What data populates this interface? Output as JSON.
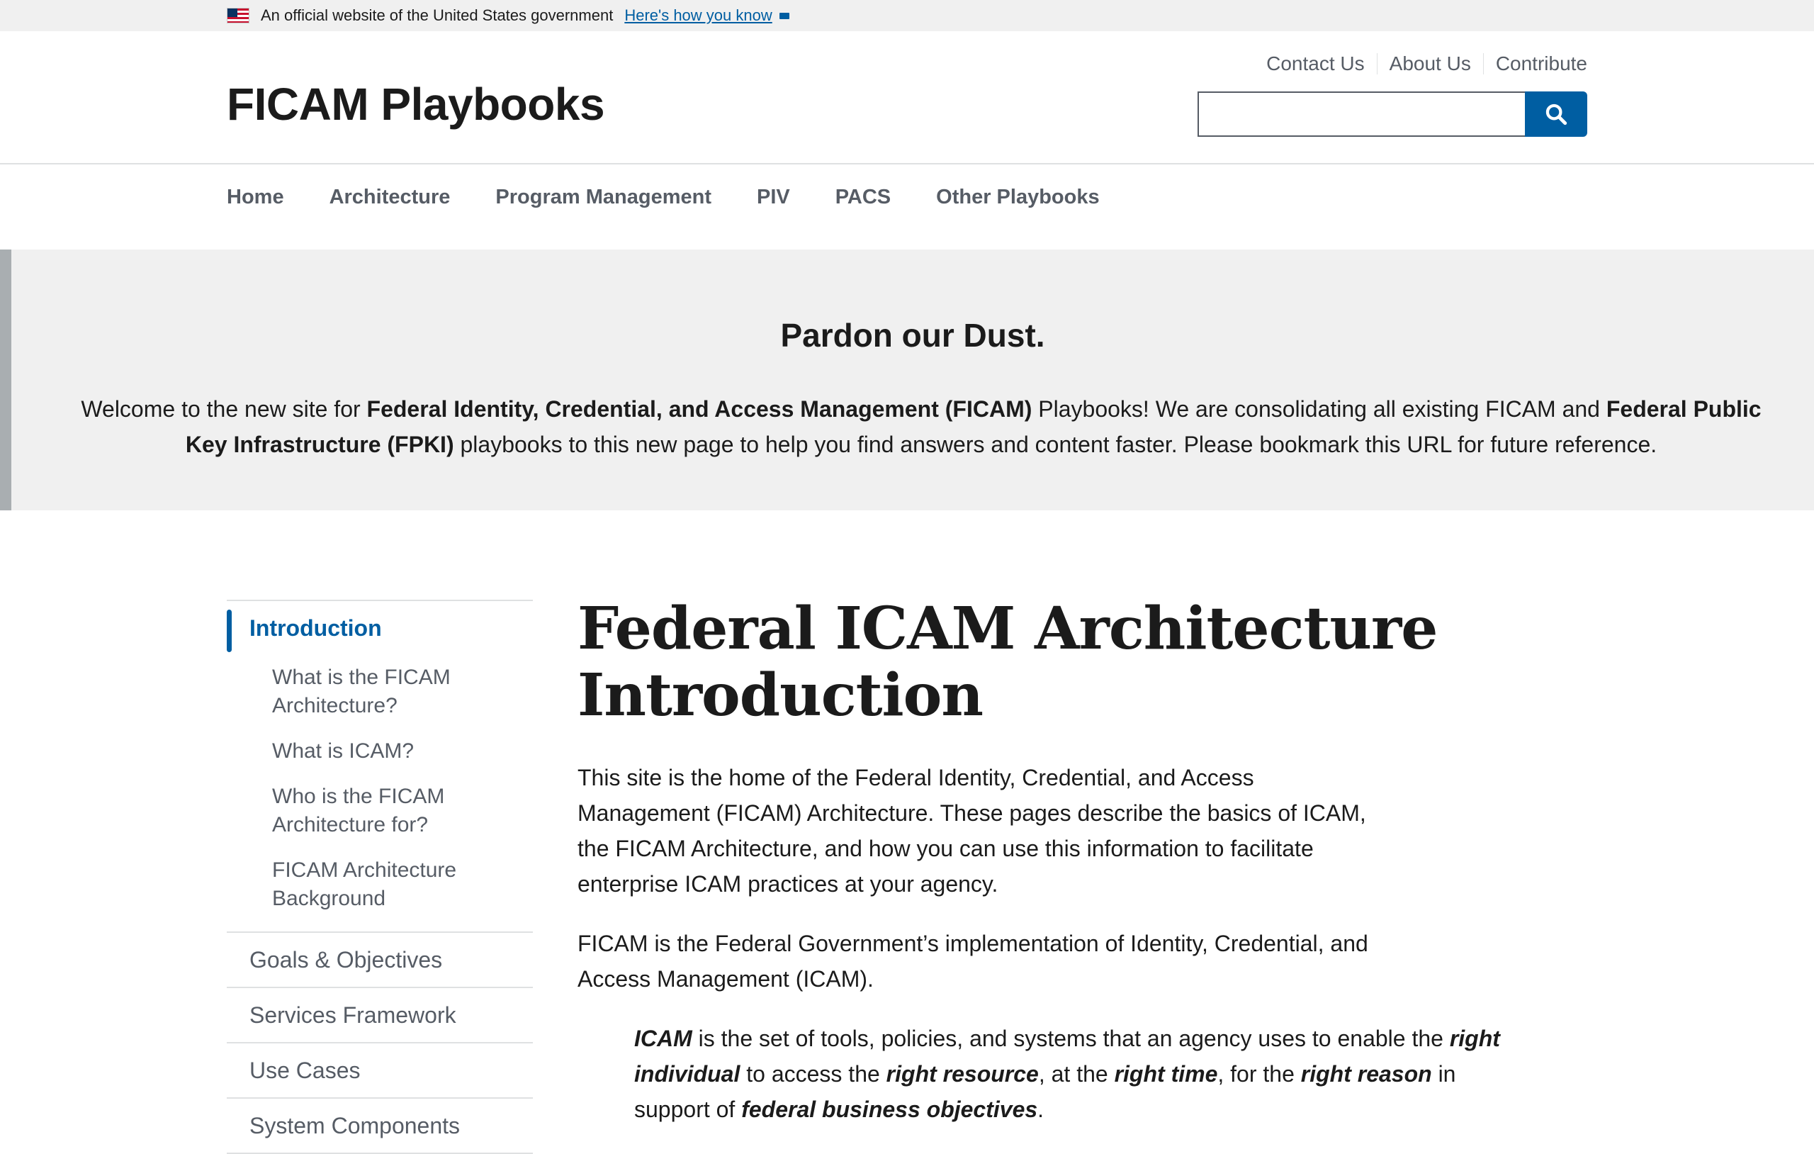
{
  "gov_banner": {
    "text": "An official website of the United States government",
    "link": "Here's how you know"
  },
  "header": {
    "title": "FICAM Playbooks",
    "secondary_links": [
      "Contact Us",
      "About Us",
      "Contribute"
    ],
    "search": {
      "value": "",
      "placeholder": ""
    }
  },
  "nav": {
    "items": [
      "Home",
      "Architecture",
      "Program Management",
      "PIV",
      "PACS",
      "Other Playbooks"
    ]
  },
  "alert": {
    "title": "Pardon our Dust.",
    "body": {
      "p1": "Welcome to the new site for ",
      "b1": "Federal Identity, Credential, and Access Management (FICAM)",
      "p2": " Playbooks! We are consolidating all existing FICAM and ",
      "b2": "Federal Public Key Infrastructure (FPKI)",
      "p3": " playbooks to this new page to help you find answers and content faster. Please bookmark this URL for future reference."
    }
  },
  "sidenav": {
    "current": "Introduction",
    "sub_items": [
      "What is the FICAM Architecture?",
      "What is ICAM?",
      "Who is the FICAM Architecture for?",
      "FICAM Architecture Background"
    ],
    "items": [
      "Goals & Objectives",
      "Services Framework",
      "Use Cases",
      "System Components"
    ]
  },
  "main": {
    "title": "Federal ICAM Architecture Introduction",
    "para1": "This site is the home of the Federal Identity, Credential, and Access Management (FICAM) Architecture. These pages describe the basics of ICAM, the FICAM Architecture, and how you can use this information to facilitate enterprise ICAM practices at your agency.",
    "para2": "FICAM is the Federal Government’s implementation of Identity, Credential, and Access Management (ICAM).",
    "quote": {
      "b1": "ICAM",
      "t1": " is the set of tools, policies, and systems that an agency uses to enable the ",
      "b2": "right individual",
      "t2": " to access the ",
      "b3": "right resource",
      "t3": ", at the ",
      "b4": "right time",
      "t4": ", for the ",
      "b5": "right reason",
      "t5": " in support of ",
      "b6": "federal business objectives",
      "t6": "."
    }
  }
}
